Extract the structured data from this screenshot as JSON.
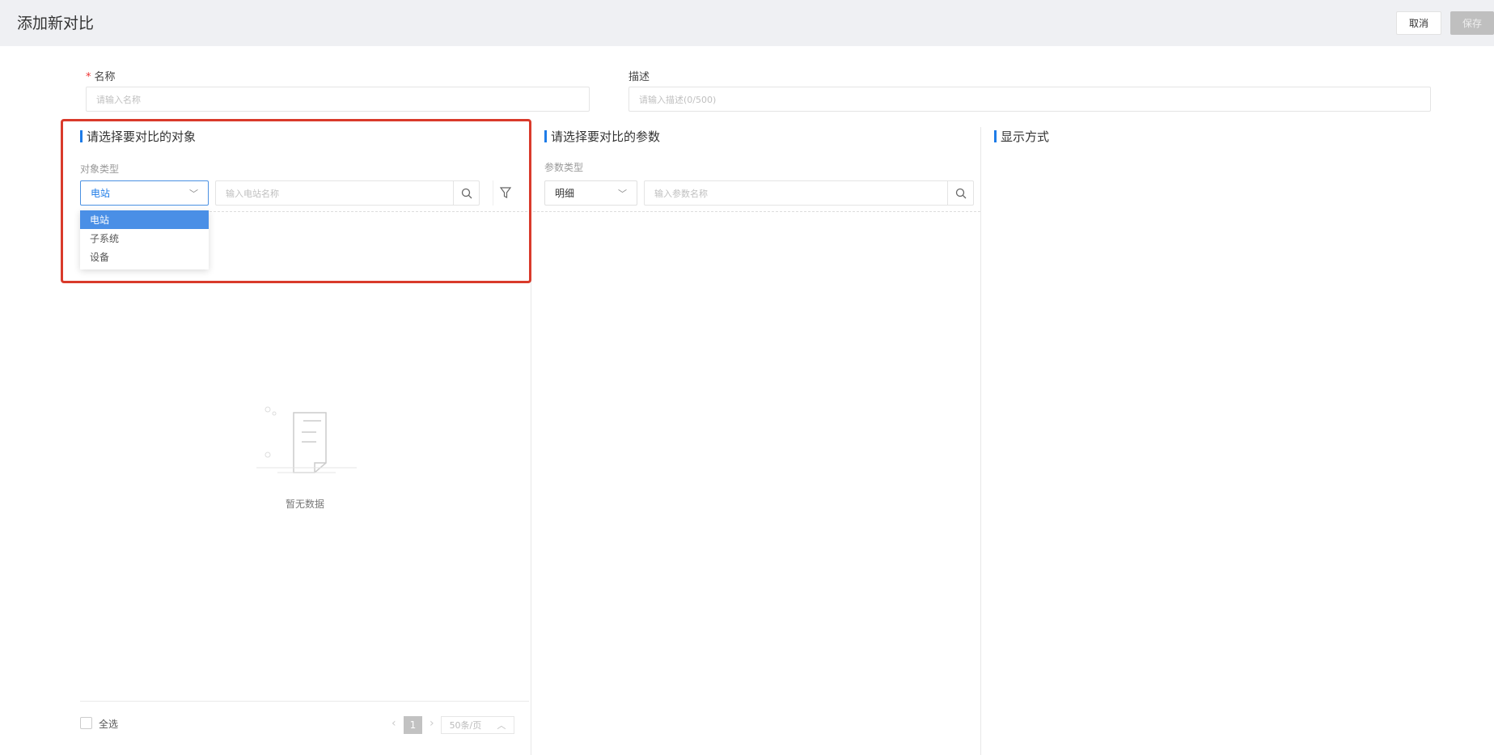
{
  "header": {
    "title": "添加新对比",
    "cancel_label": "取消",
    "save_label": "保存"
  },
  "form": {
    "name_label": "名称",
    "name_required": "*",
    "name_placeholder": "请输入名称",
    "desc_label": "描述",
    "desc_placeholder": "请输入描述(0/500)"
  },
  "objects": {
    "title": "请选择要对比的对象",
    "type_label": "对象类型",
    "type_value": "电站",
    "search_placeholder": "输入电站名称",
    "options": [
      "电站",
      "子系统",
      "设备"
    ],
    "empty_text": "暂无数据",
    "select_all": "全选",
    "page": "1",
    "page_size": "50条/页",
    "prev": "‹",
    "next": "›"
  },
  "params": {
    "title": "请选择要对比的参数",
    "type_label": "参数类型",
    "type_value": "明细",
    "search_placeholder": "输入参数名称"
  },
  "display": {
    "title": "显示方式"
  }
}
